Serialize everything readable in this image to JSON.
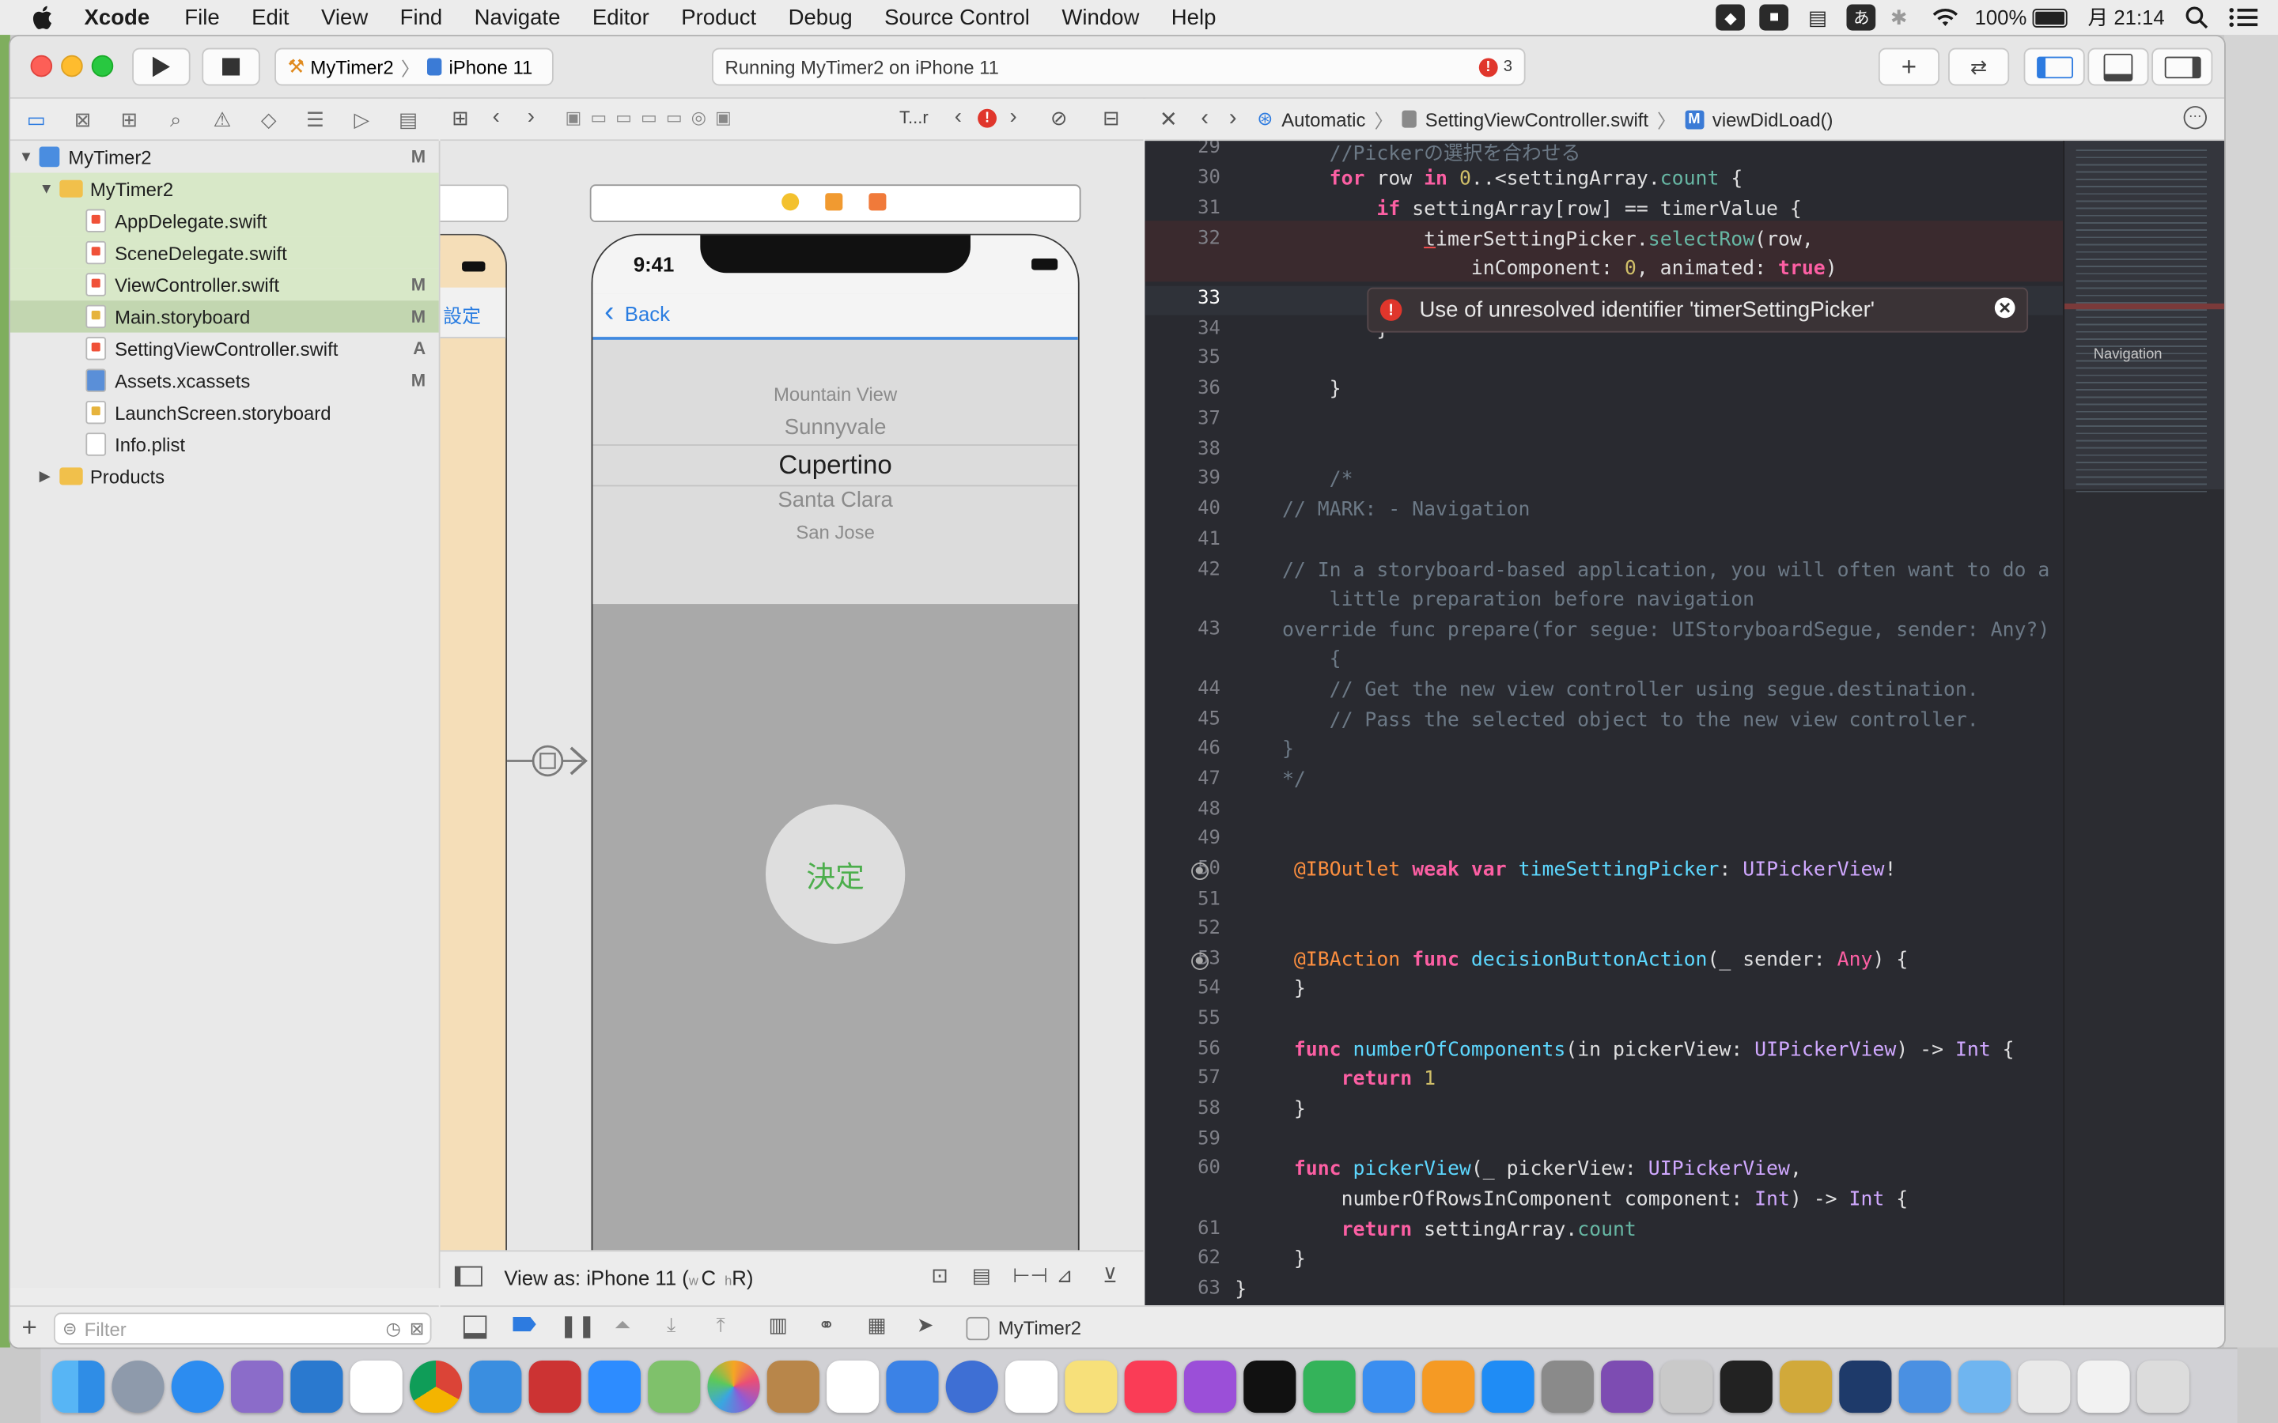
{
  "menubar": {
    "items": [
      "Xcode",
      "File",
      "Edit",
      "View",
      "Find",
      "Navigate",
      "Editor",
      "Product",
      "Debug",
      "Source Control",
      "Window",
      "Help"
    ],
    "battery": "100%",
    "clock": "月 21:14",
    "ime": "あ"
  },
  "toolbar": {
    "scheme_target": "MyTimer2",
    "scheme_device": "iPhone 11",
    "activity_text": "Running MyTimer2 on iPhone 11",
    "error_count": "3"
  },
  "navigator": {
    "rows": [
      {
        "label": "MyTimer2",
        "badge": "M"
      },
      {
        "label": "MyTimer2",
        "badge": ""
      },
      {
        "label": "AppDelegate.swift",
        "badge": ""
      },
      {
        "label": "SceneDelegate.swift",
        "badge": ""
      },
      {
        "label": "ViewController.swift",
        "badge": "M"
      },
      {
        "label": "Main.storyboard",
        "badge": "M"
      },
      {
        "label": "SettingViewController.swift",
        "badge": "A"
      },
      {
        "label": "Assets.xcassets",
        "badge": "M"
      },
      {
        "label": "LaunchScreen.storyboard",
        "badge": ""
      },
      {
        "label": "Info.plist",
        "badge": ""
      },
      {
        "label": "Products",
        "badge": ""
      }
    ],
    "filter_placeholder": "Filter"
  },
  "storyboard": {
    "jump_label": "T...r",
    "left_nav_label": "設定",
    "status_time": "9:41",
    "back_label": "Back",
    "picker_rows": [
      "Mountain View",
      "Sunnyvale",
      "Cupertino",
      "Santa Clara",
      "San Jose"
    ],
    "button_label": "決定",
    "view_as": "View as: iPhone 11 (",
    "view_as_w": "w",
    "view_as_c": "C",
    "view_as_h": "h",
    "view_as_r": "R)"
  },
  "editor": {
    "jump_items": [
      "Automatic",
      "SettingViewController.swift",
      "viewDidLoad()"
    ],
    "minimap_label": "Navigation",
    "error_message": "Use of unresolved identifier 'timerSettingPicker'",
    "line_numbers": [
      "29",
      "30",
      "31",
      "32",
      "",
      "33",
      "34",
      "35",
      "36",
      "37",
      "38",
      "39",
      "40",
      "41",
      "42",
      "",
      "43",
      "",
      "44",
      "45",
      "46",
      "47",
      "48",
      "49",
      "50",
      "51",
      "52",
      "53",
      "54",
      "55",
      "56",
      "57",
      "58",
      "59",
      "60",
      "",
      "61",
      "62",
      "63"
    ]
  },
  "bottombar": {
    "scheme_label": "MyTimer2"
  }
}
